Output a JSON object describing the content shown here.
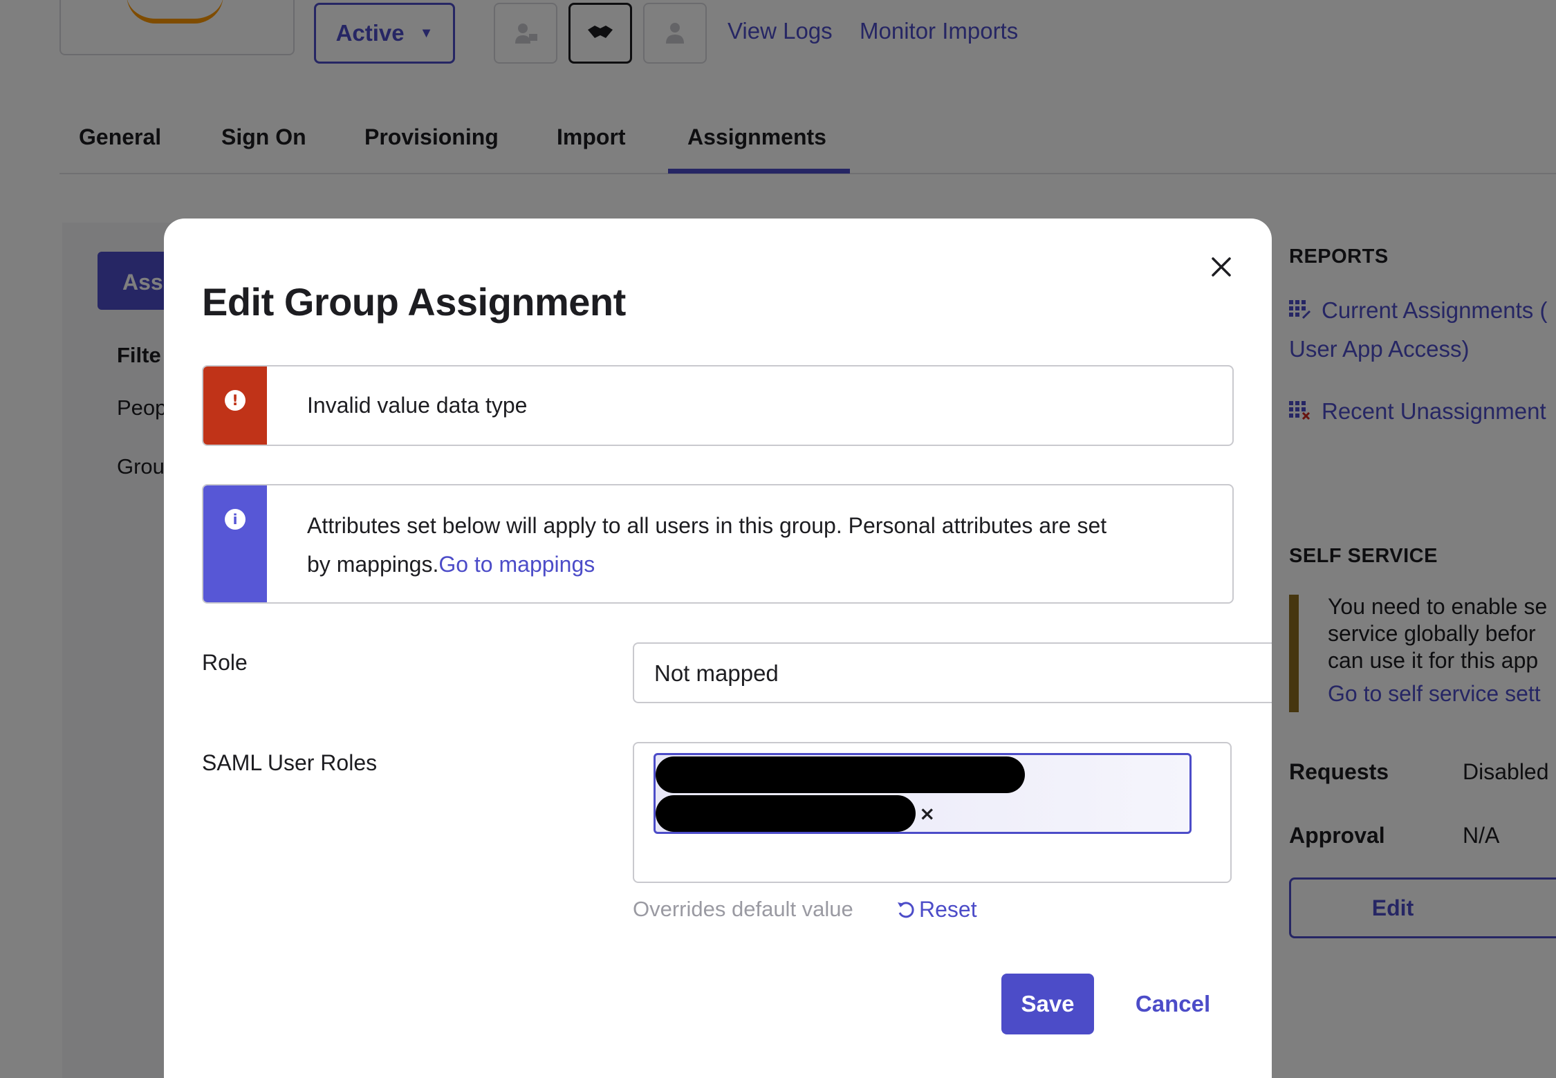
{
  "header": {
    "status_label": "Active",
    "links": [
      "View Logs",
      "Monitor Imports"
    ]
  },
  "tabs": [
    "General",
    "Sign On",
    "Provisioning",
    "Import",
    "Assignments"
  ],
  "active_tab": "Assignments",
  "sidebar": {
    "assign_button": "Ass",
    "filter_label": "Filte",
    "items": [
      "Peop",
      "Grou"
    ]
  },
  "reports": {
    "heading": "REPORTS",
    "current_assignments_line1": "Current Assignments (",
    "current_assignments_line2": "User App Access)",
    "recent_unassignments": "Recent Unassignment"
  },
  "self_service": {
    "heading": "SELF SERVICE",
    "notice_lines": [
      "You need to enable se",
      "service globally befor",
      "can use it for this app"
    ],
    "notice_link": "Go to self service sett",
    "requests_label": "Requests",
    "requests_value": "Disabled",
    "approval_label": "Approval",
    "approval_value": "N/A",
    "edit_label": "Edit"
  },
  "modal": {
    "title": "Edit Group Assignment",
    "error_message": "Invalid value data type",
    "info_message_line1": "Attributes set below will apply to all users in this group. Personal attributes are set",
    "info_message_line2": "by mappings.",
    "info_link": "Go to mappings",
    "role_label": "Role",
    "role_value": "Not mapped",
    "saml_label": "SAML User Roles",
    "chip_remove": "×",
    "hint": "Overrides default value",
    "reset_label": "Reset",
    "save_label": "Save",
    "cancel_label": "Cancel"
  },
  "colors": {
    "accent": "#4c4cc8",
    "error": "#c03318",
    "info": "#5757d6",
    "warning": "#8d6d1e"
  }
}
